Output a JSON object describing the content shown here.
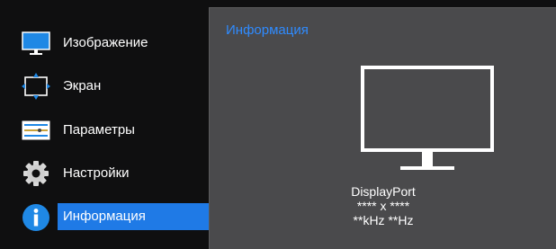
{
  "menu": {
    "items": [
      {
        "label": "Изображение",
        "icon": "monitor-icon"
      },
      {
        "label": "Экран",
        "icon": "screen-resize-icon"
      },
      {
        "label": "Параметры",
        "icon": "sliders-icon"
      },
      {
        "label": "Настройки",
        "icon": "gear-icon"
      },
      {
        "label": "Информация",
        "icon": "info-icon",
        "active": true
      }
    ]
  },
  "panel": {
    "title": "Информация",
    "source": "DisplayPort",
    "resolution": "**** x ****",
    "frequency": "**kHz **Hz"
  },
  "colors": {
    "accent": "#1f7ae6",
    "title": "#2f8bff",
    "panel_bg": "#4a4a4c",
    "menu_bg": "#0f0f10"
  }
}
